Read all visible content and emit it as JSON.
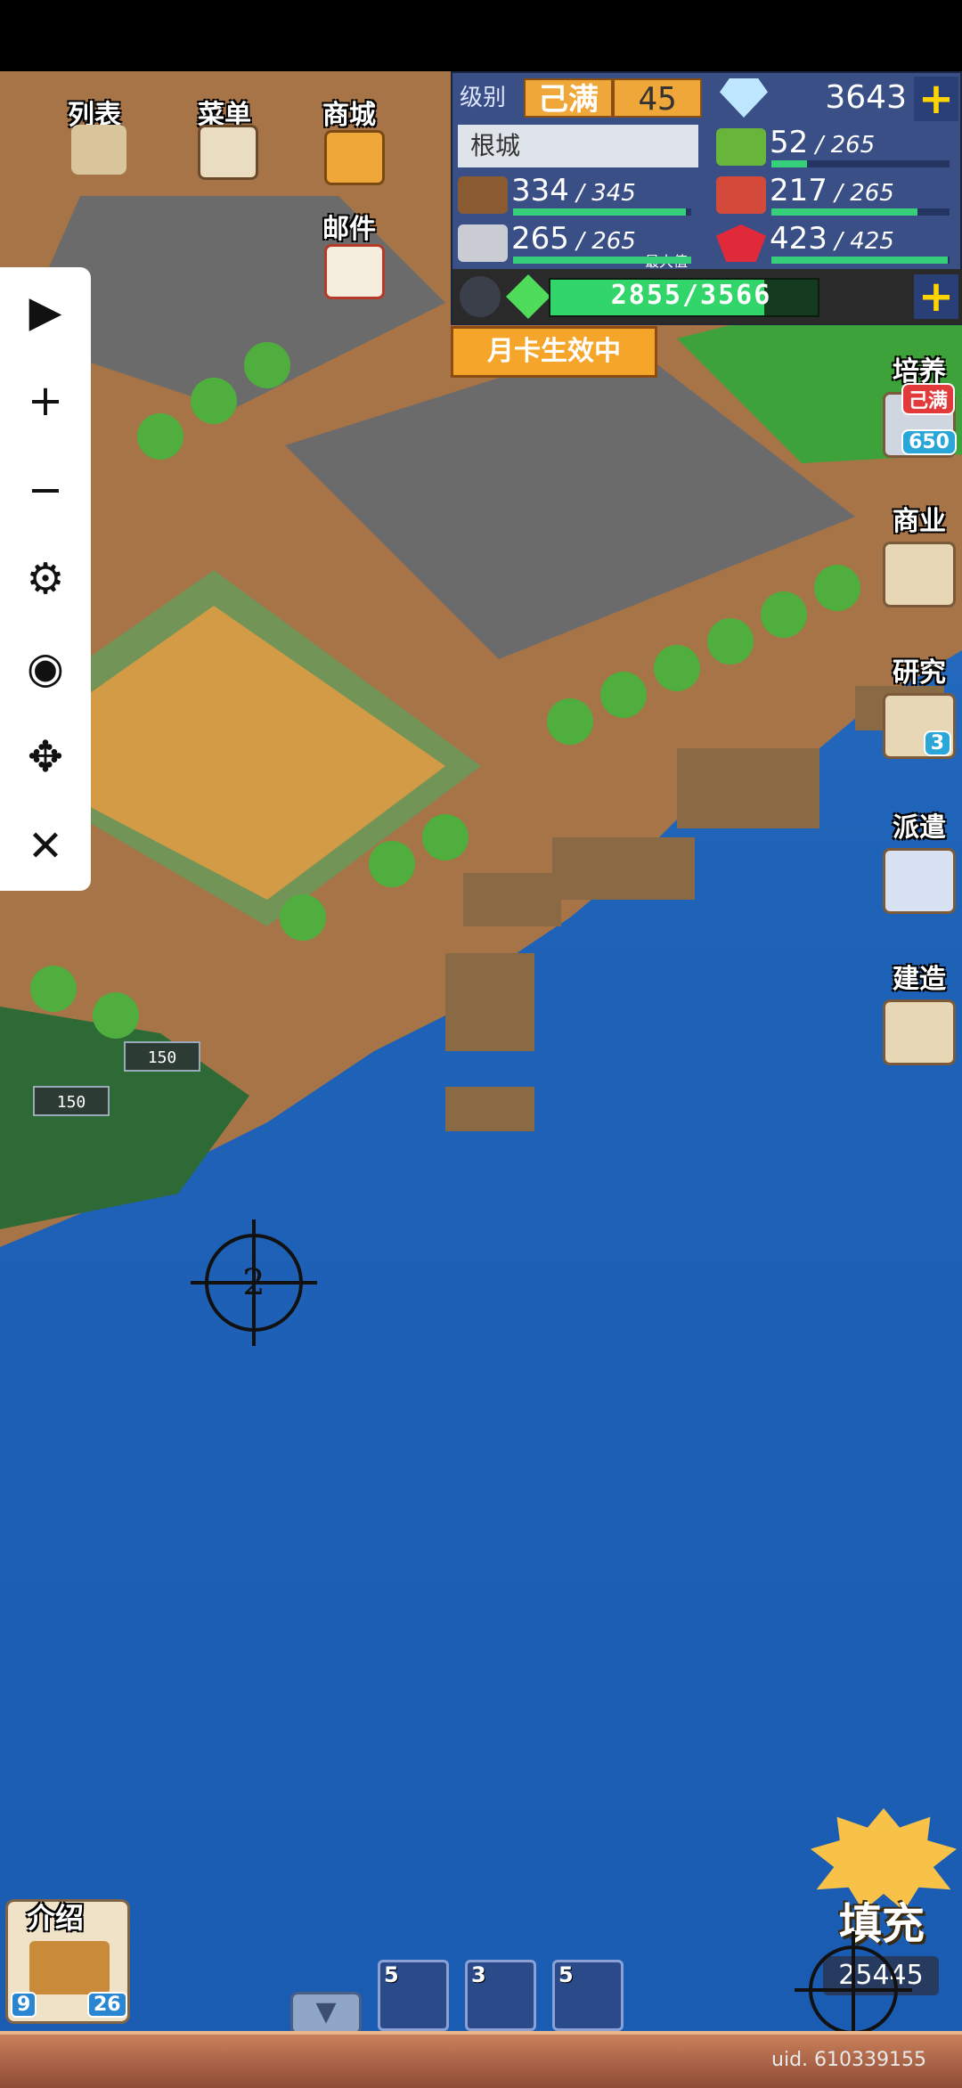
{
  "top_menu": {
    "list_label": "列表",
    "menu_label": "菜单",
    "shop_label": "商城",
    "mail_label": "邮件"
  },
  "hud": {
    "level_label": "级别",
    "level_status": "己满",
    "level_value": "45",
    "diamonds": "3643",
    "city_name": "根城",
    "food": {
      "current": "52",
      "max": "265"
    },
    "wood": {
      "current": "334",
      "max": "345"
    },
    "fruit": {
      "current": "217",
      "max": "265"
    },
    "ore": {
      "current": "265",
      "max": "265",
      "note": "最大值"
    },
    "ruby": {
      "current": "423",
      "max": "425"
    },
    "gems": "2855/3566",
    "gems_fill": 0.8,
    "plus_symbol": "+"
  },
  "month_card": "月卡生效中",
  "tools": {
    "play": "▶",
    "zoom_in": "+",
    "zoom_out": "−",
    "settings": "⚙",
    "hide": "◉",
    "move": "✥",
    "close": "✕"
  },
  "side_menu": {
    "train_label": "培养",
    "train_badge": "己满",
    "train_count": "650",
    "business_label": "商业",
    "research_label": "研究",
    "research_count": "3",
    "dispatch_label": "派遣",
    "build_label": "建造"
  },
  "map": {
    "plot_price_1": "150",
    "plot_price_2": "150",
    "crosshair_label": "2"
  },
  "intro": {
    "label": "介绍",
    "left_badge": "9",
    "right_badge": "26"
  },
  "bottom_slots": [
    {
      "count": "5"
    },
    {
      "count": "3"
    },
    {
      "count": "5"
    }
  ],
  "dropdown_symbol": "▼",
  "fill_button": {
    "label": "填充",
    "count": "25445"
  },
  "uid": "uid. 610339155",
  "colors": {
    "sea": "#1f63b8",
    "land": "#a67447",
    "grass": "#4fae3e",
    "hud_bg": "#3a4f86",
    "accent_gold": "#f0a73a"
  }
}
